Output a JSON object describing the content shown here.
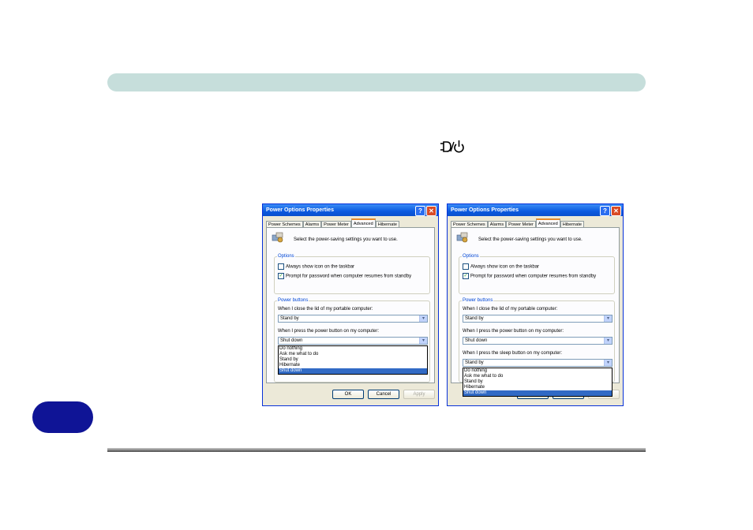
{
  "dialogs": [
    {
      "title": "Power Options Properties",
      "tabs": [
        "Power Schemes",
        "Alarms",
        "Power Meter",
        "Advanced",
        "Hibernate"
      ],
      "active_tab": "Advanced",
      "intro": "Select the power-saving settings you want to use.",
      "options_label": "Options",
      "option1": "Always show icon on the taskbar",
      "option2": "Prompt for password when computer resumes from standby",
      "power_buttons_label": "Power buttons",
      "lid_label": "When I close the lid of my portable computer:",
      "lid_value": "Stand by",
      "power_label": "When I press the power button on my computer:",
      "power_value": "Shut down",
      "dropdown_items": [
        "Do nothing",
        "Ask me what to do",
        "Stand by",
        "Hibernate",
        "Shut down"
      ],
      "buttons": [
        "OK",
        "Cancel",
        "Apply"
      ]
    },
    {
      "title": "Power Options Properties",
      "tabs": [
        "Power Schemes",
        "Alarms",
        "Power Meter",
        "Advanced",
        "Hibernate"
      ],
      "active_tab": "Advanced",
      "intro": "Select the power-saving settings you want to use.",
      "options_label": "Options",
      "option1": "Always show icon on the taskbar",
      "option2": "Prompt for password when computer resumes from standby",
      "power_buttons_label": "Power buttons",
      "lid_label": "When I close the lid of my portable computer:",
      "lid_value": "Stand by",
      "power_label": "When I press the power button on my computer:",
      "power_value": "Shut down",
      "sleep_label": "When I press the sleep button on my computer:",
      "sleep_value": "Stand by",
      "dropdown_items": [
        "Do nothing",
        "Ask me what to do",
        "Stand by",
        "Hibernate",
        "Shut down"
      ]
    }
  ],
  "colors": {
    "header_bar": "#c6dedb",
    "page_tab": "#0f1496",
    "xp_title_blue": "#0b5ae0",
    "selection_blue": "#316ac5"
  },
  "icons": [
    "power-sleep-icon",
    "help-icon",
    "close-icon",
    "power-options-icon",
    "chevron-down-icon",
    "checkmark-icon"
  ]
}
